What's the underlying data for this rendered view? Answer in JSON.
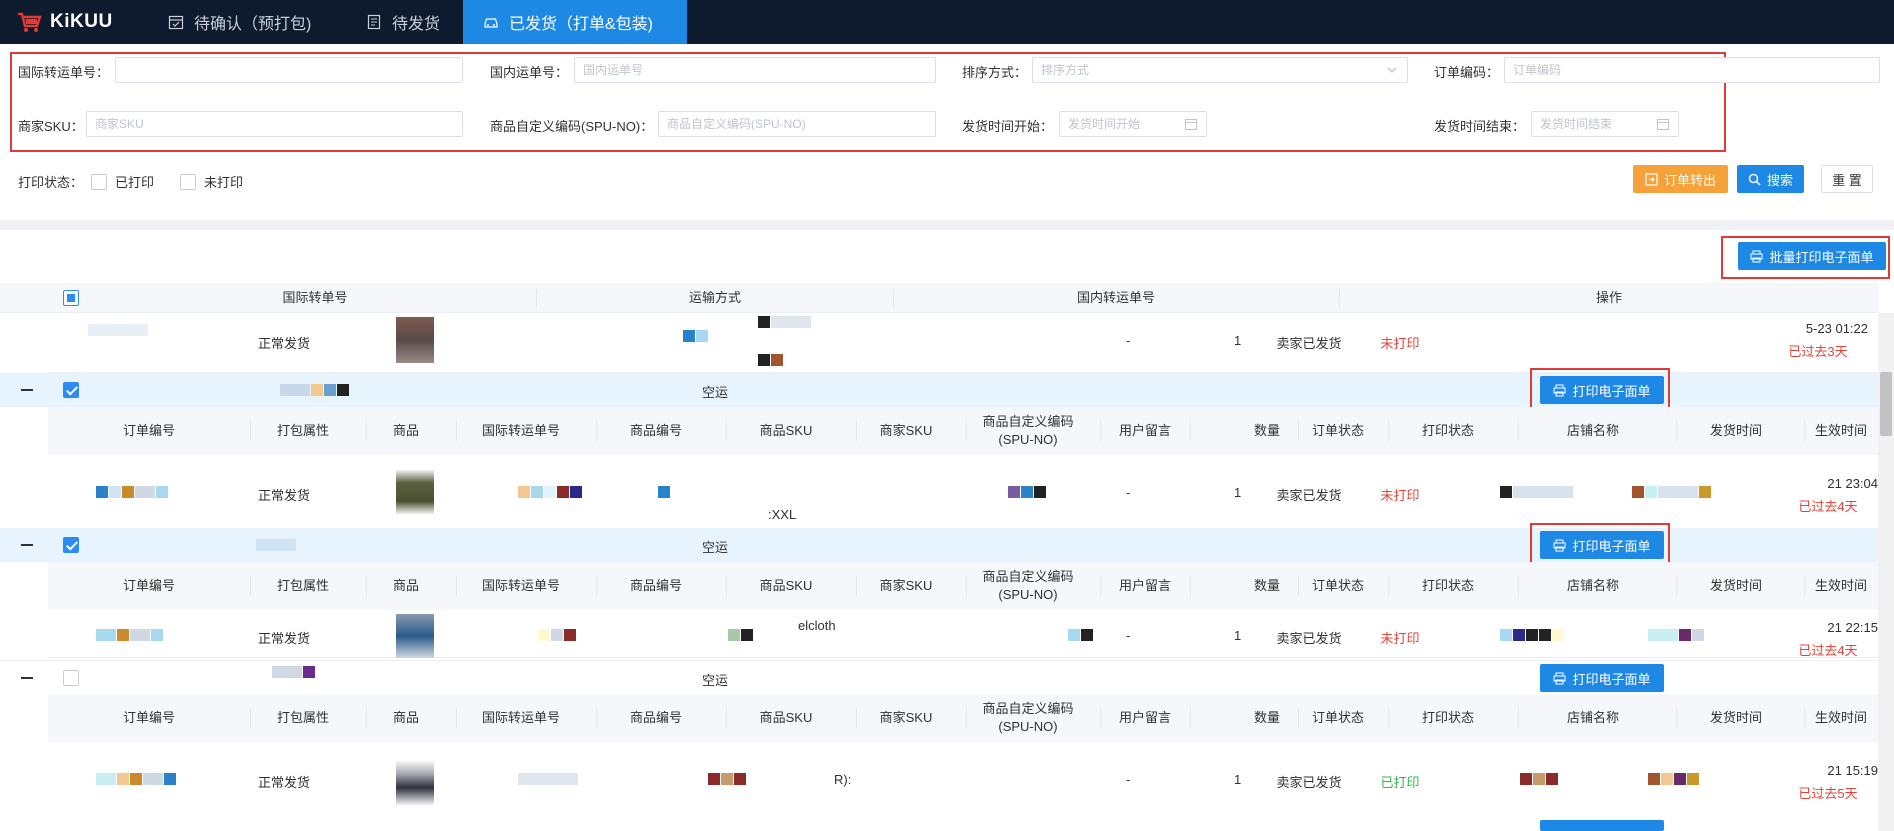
{
  "app": {
    "brand": "KiKUU"
  },
  "nav": {
    "tabs": [
      {
        "label": "待确认（预打包)"
      },
      {
        "label": "待发货"
      },
      {
        "label": "已发货（打单&包装)"
      }
    ]
  },
  "filters": {
    "intl_tracking_label": "国际转运单号：",
    "intl_tracking_value": "",
    "domestic_tracking_label": "国内运单号：",
    "domestic_tracking_placeholder": "国内运单号",
    "sort_label": "排序方式：",
    "sort_placeholder": "排序方式",
    "order_code_label": "订单编码：",
    "order_code_placeholder": "订单编码",
    "merchant_sku_label": "商家SKU：",
    "merchant_sku_placeholder": "商家SKU",
    "spu_label": "商品自定义编码(SPU-NO)：",
    "spu_placeholder": "商品自定义编码(SPU-NO)",
    "ship_start_label": "发货时间开始：",
    "ship_start_placeholder": "发货时间开始",
    "ship_end_label": "发货时间结束：",
    "ship_end_placeholder": "发货时间结束",
    "print_status_label": "打印状态：",
    "printed_option": "已打印",
    "unprinted_option": "未打印"
  },
  "actions": {
    "export_label": "订单转出",
    "search_label": "搜索",
    "reset_label": "重 置",
    "batch_print_label": "批量打印电子面单",
    "print_label": "打印电子面单"
  },
  "main_headers": [
    "国际转单号",
    "运输方式",
    "国内转运单号",
    "操作"
  ],
  "sub_headers": [
    "订单编号",
    "打包属性",
    "商品",
    "国际转运单号",
    "商品编号",
    "商品SKU",
    "商家SKU",
    "商品自定义编码\n(SPU-NO)",
    "用户留言",
    "数量",
    "订单状态",
    "打印状态",
    "店铺名称",
    "发货时间",
    "生效时间"
  ],
  "partial_row": {
    "pack_attr": "正常发货",
    "note": "-",
    "qty": "1",
    "order_status": "卖家已发货",
    "print_status": "未打印",
    "effective_time": "5-23 01:22",
    "overdue": "已过去3天"
  },
  "groups": [
    {
      "shipping": "空运",
      "row": {
        "pack_attr": "正常发货",
        "sku_extra": ":XXL",
        "note": "-",
        "qty": "1",
        "order_status": "卖家已发货",
        "print_status": "未打印",
        "effective_time": "21 23:04",
        "overdue": "已过去4天"
      }
    },
    {
      "shipping": "空运",
      "row": {
        "pack_attr": "正常发货",
        "sku_extra": "elcloth",
        "note": "-",
        "qty": "1",
        "order_status": "卖家已发货",
        "print_status": "未打印",
        "effective_time": "21 22:15",
        "overdue": "已过去4天"
      }
    },
    {
      "shipping": "空运",
      "row": {
        "pack_attr": "正常发货",
        "sku_extra": "R):",
        "note": "-",
        "qty": "1",
        "order_status": "卖家已发货",
        "print_status": "已打印",
        "effective_time": "21 15:19",
        "overdue": "已过去5天"
      }
    }
  ],
  "colors": {
    "accent": "#1e88e5",
    "warning": "#f6a23a",
    "danger": "#e0443b",
    "success": "#2db84d",
    "highlight": "#e03a3a"
  }
}
